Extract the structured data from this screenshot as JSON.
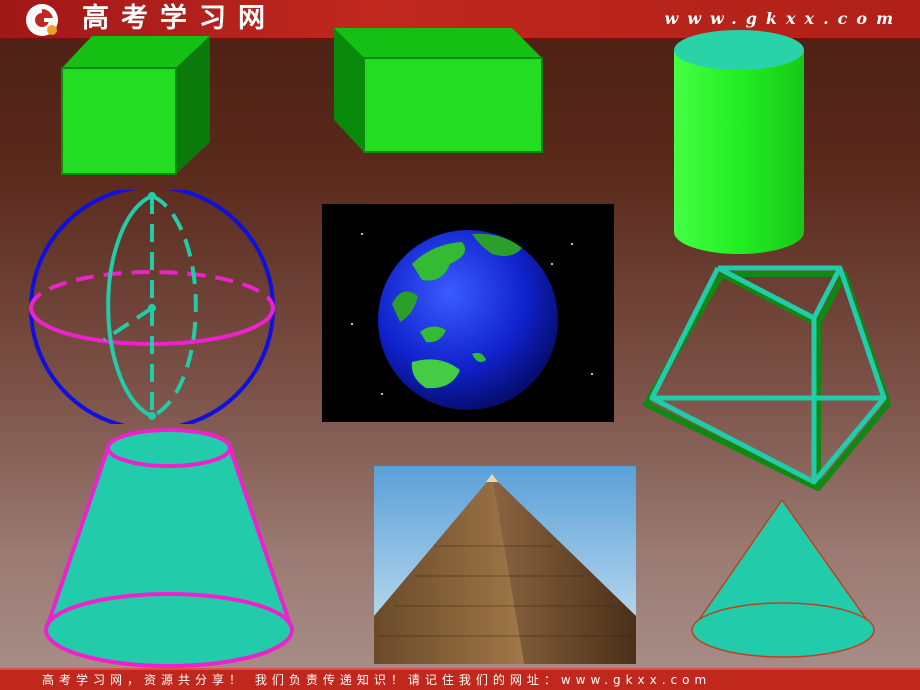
{
  "header": {
    "site_name": "高考学习网",
    "url": "www.gkxx.com"
  },
  "footer": {
    "slogan": "高考学习网，资源共分享！ 我们负责传递知识！请记住我们的网址：www.gkxx.com"
  },
  "colors": {
    "header_red": "#c0281e",
    "solid_green": "#22dd22",
    "teal": "#22ccaa",
    "magenta": "#ee22cc",
    "blue": "#1010dd"
  },
  "shapes": [
    "cube",
    "rectangular-prism",
    "cylinder",
    "sphere",
    "earth-photo",
    "frustum-wireframe",
    "truncated-cone",
    "pyramid-photo",
    "cone"
  ]
}
